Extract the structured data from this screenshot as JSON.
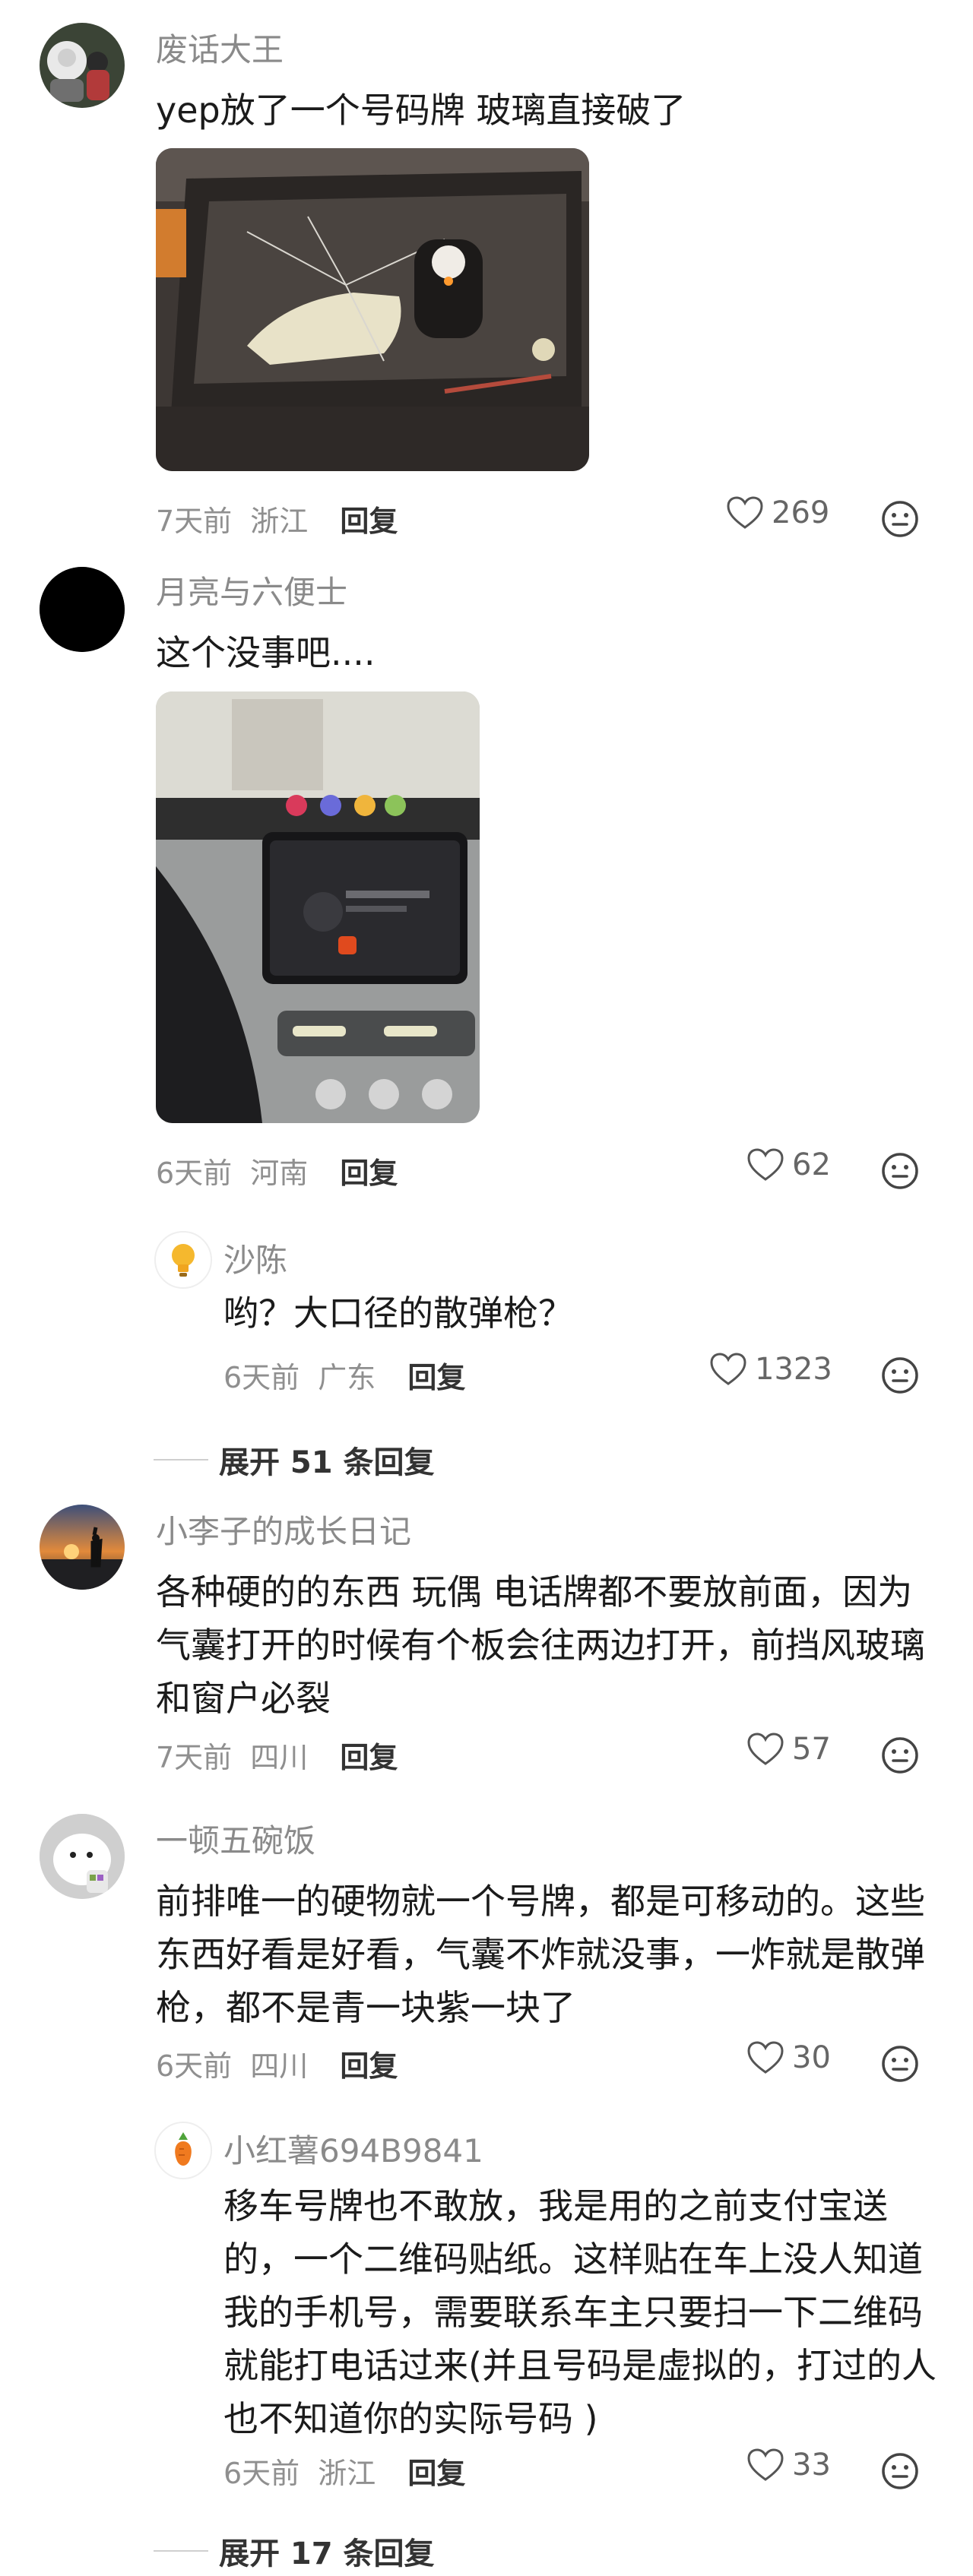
{
  "comments": [
    {
      "username": "废话大王",
      "text": "yep放了一个号码牌 玻璃直接破了",
      "time": "7天前",
      "location": "浙江",
      "reply_label": "回复",
      "likes": "269"
    },
    {
      "username": "月亮与六便士",
      "text": "这个没事吧....",
      "time": "6天前",
      "location": "河南",
      "reply_label": "回复",
      "likes": "62",
      "replies": [
        {
          "username": "沙陈",
          "text": "哟？大口径的散弹枪？",
          "time": "6天前",
          "location": "广东",
          "reply_label": "回复",
          "likes": "1323"
        }
      ],
      "expand_label": "展开 51 条回复"
    },
    {
      "username": "小李子的成长日记",
      "text": "各种硬的的东西 玩偶 电话牌都不要放前面，因为气囊打开的时候有个板会往两边打开，前挡风玻璃和窗户必裂",
      "time": "7天前",
      "location": "四川",
      "reply_label": "回复",
      "likes": "57"
    },
    {
      "username": "一顿五碗饭",
      "text": "前排唯一的硬物就一个号牌，都是可移动的。这些东西好看是好看，气囊不炸就没事，一炸就是散弹枪，都不是青一块紫一块了",
      "time": "6天前",
      "location": "四川",
      "reply_label": "回复",
      "likes": "30",
      "replies": [
        {
          "username": "小红薯694B9841",
          "text": "移车号牌也不敢放，我是用的之前支付宝送的，一个二维码贴纸。这样贴在车上没人知道我的手机号，需要联系车主只要扫一下二维码就能打电话过来(并且号码是虚拟的，打过的人也不知道你的实际号码 )",
          "time": "6天前",
          "location": "浙江",
          "reply_label": "回复",
          "likes": "33"
        }
      ],
      "expand_label": "展开 17 条回复"
    }
  ],
  "icons": {
    "like": "heart-outline-icon",
    "emoji": "smiley-face-icon"
  },
  "colors": {
    "meta_gray": "#8f8f8f",
    "name_gray": "#8a8a8a",
    "text": "#1b1b1b"
  }
}
